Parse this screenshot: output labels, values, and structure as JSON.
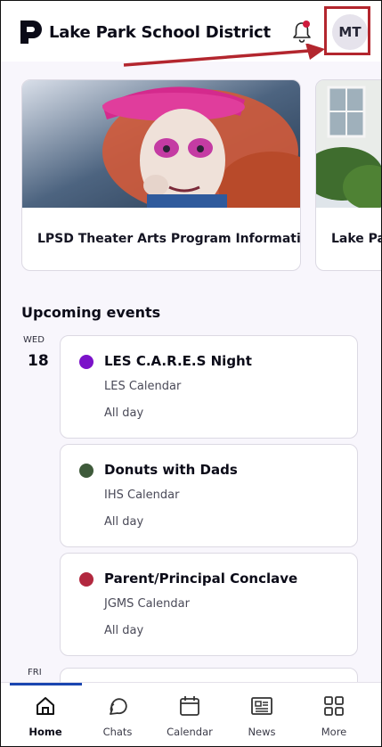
{
  "header": {
    "title": "Lake Park School District",
    "avatar_initials": "MT",
    "has_notification": true
  },
  "carousel": [
    {
      "title": "LPSD Theater Arts Program Information"
    },
    {
      "title": "Lake Pa"
    }
  ],
  "events_section": {
    "title": "Upcoming events",
    "days": [
      {
        "dow": "WED",
        "day": "18",
        "events": [
          {
            "title": "LES C.A.R.E.S Night",
            "calendar": "LES Calendar",
            "time": "All day",
            "color": "#7b12c9"
          },
          {
            "title": "Donuts with Dads",
            "calendar": "IHS Calendar",
            "time": "All day",
            "color": "#3e5a3a"
          },
          {
            "title": "Parent/Principal Conclave",
            "calendar": "JGMS Calendar",
            "time": "All day",
            "color": "#b2283f"
          }
        ]
      },
      {
        "dow": "FRI"
      }
    ]
  },
  "bottom_nav": [
    {
      "label": "Home",
      "icon": "home-icon",
      "active": true
    },
    {
      "label": "Chats",
      "icon": "chat-icon",
      "active": false
    },
    {
      "label": "Calendar",
      "icon": "calendar-icon",
      "active": false
    },
    {
      "label": "News",
      "icon": "news-icon",
      "active": false
    },
    {
      "label": "More",
      "icon": "grid-icon",
      "active": false
    }
  ],
  "colors": {
    "accent": "#1a45b0",
    "highlight": "#b3262e",
    "notification": "#cf1b3c"
  }
}
